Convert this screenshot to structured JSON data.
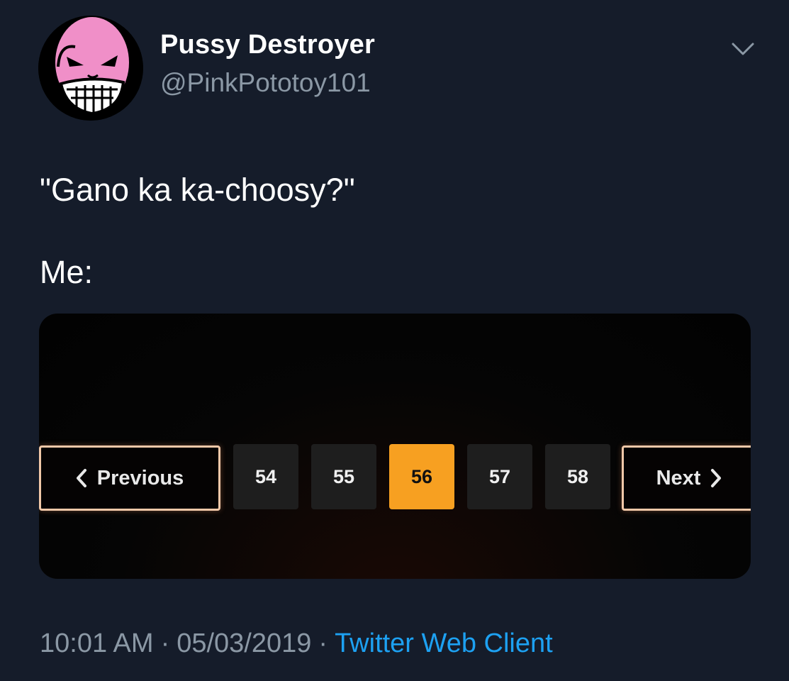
{
  "tweet": {
    "display_name": "Pussy Destroyer",
    "handle": "@PinkPototoy101",
    "text_line1": "\"Gano ka ka-choosy?\"",
    "text_line2": "Me:",
    "time": "10:01 AM",
    "date": "05/03/2019",
    "separator": "·",
    "client": "Twitter Web Client"
  },
  "pagination": {
    "previous_label": "Previous",
    "next_label": "Next",
    "pages": [
      "54",
      "55",
      "56",
      "57",
      "58"
    ],
    "active_page": "56"
  },
  "colors": {
    "background": "#151c2a",
    "secondary_text": "#8b98a5",
    "link": "#1da1f2",
    "active_page": "#f7a021",
    "avatar_face": "#f08fc8"
  },
  "icons": {
    "menu": "chevron-down-icon",
    "previous": "chevron-left-icon",
    "next": "chevron-right-icon"
  }
}
